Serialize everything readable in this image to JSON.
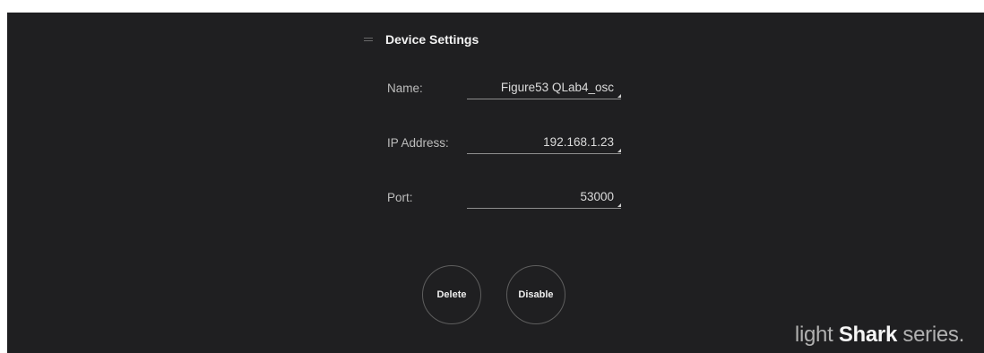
{
  "section": {
    "title": "Device Settings"
  },
  "fields": {
    "name": {
      "label": "Name:",
      "value": "Figure53 QLab4_osc"
    },
    "ip": {
      "label": "IP Address:",
      "value": "192.168.1.23"
    },
    "port": {
      "label": "Port:",
      "value": "53000"
    }
  },
  "buttons": {
    "delete": "Delete",
    "disable": "Disable"
  },
  "brand": {
    "prefix": "light",
    "bold": "Shark",
    "suffix": "series."
  },
  "colors": {
    "background": "#1f1f21",
    "page": "#ffffff",
    "text": "#c9c9c9",
    "title": "#f2f2f2"
  },
  "icons": {
    "collapse": "collapse-icon",
    "dropdown_corner": "corner-triangle-icon"
  }
}
